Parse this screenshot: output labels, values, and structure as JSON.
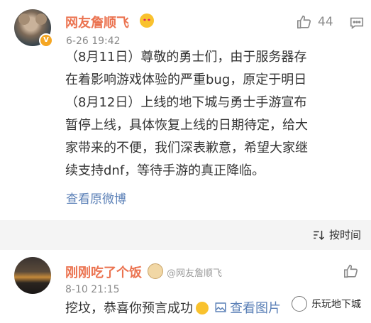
{
  "post": {
    "username": "网友詹顺飞",
    "timestamp": "6-26 19:42",
    "likes": "44",
    "body": "（8月11日）尊敬的勇士们，由于服务器存\n在着影响游戏体验的严重bug，原定于明日\n（8月12日）上线的地下城与勇士手游宣布\n暂停上线，具体恢复上线的日期待定，给大\n家带来的不便，我们深表歉意，希望大家继\n续支持dnf，等待手游的真正降临。",
    "view_original": "查看原微博",
    "verified_badge": "V"
  },
  "sort": {
    "label": "按时间"
  },
  "comment": {
    "username": "刚刚吃了个饭",
    "mention": "@网友詹顺飞",
    "timestamp": "8-10 21:15",
    "text_before": "挖坟，恭喜你预言成功",
    "pic_link": "查看图片"
  },
  "watermark": {
    "text": "乐玩地下城"
  },
  "icons": {
    "like": "thumbs-up-icon",
    "comment": "comment-icon",
    "sort": "sort-icon",
    "picture": "picture-icon",
    "emoji": "emoji-icon"
  },
  "colors": {
    "username": "#eb7350",
    "link": "#5b80b7",
    "meta": "#8a8a8a"
  }
}
